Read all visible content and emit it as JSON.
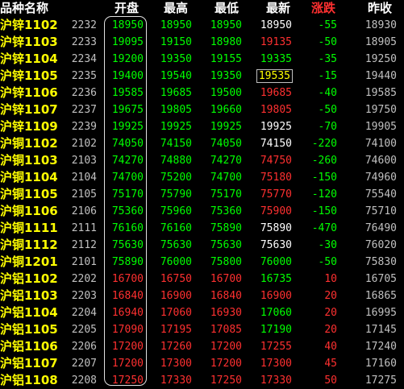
{
  "colors": {
    "header_label": "#ffffff",
    "header_change": "#ff3030",
    "name": "#ffff00",
    "up": "#ff3030",
    "down": "#00ff00",
    "flat": "#ffffff",
    "background": "#000000"
  },
  "headers": {
    "name": "品种名称",
    "open": "开盘",
    "high": "最高",
    "low": "最低",
    "last": "最新",
    "change": "涨跌",
    "prev_close": "昨收"
  },
  "rows": [
    {
      "name": "沪锌1102",
      "code": "2232",
      "open": "18950",
      "high": "18950",
      "low": "18950",
      "last": "18950",
      "change": "-55",
      "prev": "18930",
      "oc": "green",
      "hc": "green",
      "lc": "green",
      "lac": "white",
      "cc": "green"
    },
    {
      "name": "沪锌1103",
      "code": "2233",
      "open": "19095",
      "high": "19150",
      "low": "18980",
      "last": "19135",
      "change": "-50",
      "prev": "18905",
      "oc": "green",
      "hc": "green",
      "lc": "green",
      "lac": "red",
      "cc": "green"
    },
    {
      "name": "沪锌1104",
      "code": "2234",
      "open": "19200",
      "high": "19350",
      "low": "19155",
      "last": "19335",
      "change": "-35",
      "prev": "19250",
      "oc": "green",
      "hc": "green",
      "lc": "green",
      "lac": "green",
      "cc": "green"
    },
    {
      "name": "沪锌1105",
      "code": "2235",
      "open": "19400",
      "high": "19540",
      "low": "19350",
      "last": "19535",
      "change": "-15",
      "prev": "19440",
      "oc": "green",
      "hc": "green",
      "lc": "green",
      "lac": "cur",
      "cc": "green"
    },
    {
      "name": "沪锌1106",
      "code": "2236",
      "open": "19585",
      "high": "19685",
      "low": "19500",
      "last": "19685",
      "change": "-40",
      "prev": "19585",
      "oc": "green",
      "hc": "green",
      "lc": "green",
      "lac": "red",
      "cc": "green"
    },
    {
      "name": "沪锌1107",
      "code": "2237",
      "open": "19675",
      "high": "19805",
      "low": "19660",
      "last": "19805",
      "change": "-50",
      "prev": "19750",
      "oc": "green",
      "hc": "green",
      "lc": "green",
      "lac": "red",
      "cc": "green"
    },
    {
      "name": "沪锌1109",
      "code": "2239",
      "open": "19925",
      "high": "19925",
      "low": "19925",
      "last": "19925",
      "change": "-70",
      "prev": "19905",
      "oc": "green",
      "hc": "green",
      "lc": "green",
      "lac": "white",
      "cc": "green"
    },
    {
      "name": "沪铜1102",
      "code": "2102",
      "open": "74050",
      "high": "74150",
      "low": "74050",
      "last": "74150",
      "change": "-220",
      "prev": "74100",
      "oc": "green",
      "hc": "green",
      "lc": "green",
      "lac": "white",
      "cc": "green"
    },
    {
      "name": "沪铜1103",
      "code": "2103",
      "open": "74270",
      "high": "74880",
      "low": "74270",
      "last": "74750",
      "change": "-260",
      "prev": "74600",
      "oc": "green",
      "hc": "green",
      "lc": "green",
      "lac": "red",
      "cc": "green"
    },
    {
      "name": "沪铜1104",
      "code": "2104",
      "open": "74700",
      "high": "75200",
      "low": "74700",
      "last": "75180",
      "change": "-150",
      "prev": "74960",
      "oc": "green",
      "hc": "green",
      "lc": "green",
      "lac": "red",
      "cc": "green"
    },
    {
      "name": "沪铜1105",
      "code": "2105",
      "open": "75170",
      "high": "75790",
      "low": "75170",
      "last": "75770",
      "change": "-120",
      "prev": "75540",
      "oc": "green",
      "hc": "green",
      "lc": "green",
      "lac": "red",
      "cc": "green"
    },
    {
      "name": "沪铜1106",
      "code": "2106",
      "open": "75360",
      "high": "75960",
      "low": "75360",
      "last": "75900",
      "change": "-150",
      "prev": "75710",
      "oc": "green",
      "hc": "green",
      "lc": "green",
      "lac": "red",
      "cc": "green"
    },
    {
      "name": "沪铜1111",
      "code": "2111",
      "open": "76160",
      "high": "76160",
      "low": "75890",
      "last": "75890",
      "change": "-470",
      "prev": "76490",
      "oc": "green",
      "hc": "green",
      "lc": "green",
      "lac": "white",
      "cc": "green"
    },
    {
      "name": "沪铜1112",
      "code": "2112",
      "open": "75630",
      "high": "75630",
      "low": "75630",
      "last": "75630",
      "change": "-30",
      "prev": "76020",
      "oc": "green",
      "hc": "green",
      "lc": "green",
      "lac": "white",
      "cc": "green"
    },
    {
      "name": "沪铜1201",
      "code": "2101",
      "open": "75890",
      "high": "76000",
      "low": "75800",
      "last": "76000",
      "change": "-50",
      "prev": "75830",
      "oc": "green",
      "hc": "green",
      "lc": "green",
      "lac": "green",
      "cc": "green"
    },
    {
      "name": "沪铝1102",
      "code": "2202",
      "open": "16700",
      "high": "16750",
      "low": "16700",
      "last": "16735",
      "change": "10",
      "prev": "16705",
      "oc": "red",
      "hc": "red",
      "lc": "red",
      "lac": "green",
      "cc": "red"
    },
    {
      "name": "沪铝1103",
      "code": "2203",
      "open": "16840",
      "high": "16900",
      "low": "16840",
      "last": "16900",
      "change": "20",
      "prev": "16865",
      "oc": "red",
      "hc": "red",
      "lc": "red",
      "lac": "red",
      "cc": "red"
    },
    {
      "name": "沪铝1104",
      "code": "2204",
      "open": "16940",
      "high": "17060",
      "low": "16930",
      "last": "17060",
      "change": "20",
      "prev": "16995",
      "oc": "red",
      "hc": "red",
      "lc": "red",
      "lac": "green",
      "cc": "red"
    },
    {
      "name": "沪铝1105",
      "code": "2205",
      "open": "17090",
      "high": "17195",
      "low": "17085",
      "last": "17190",
      "change": "20",
      "prev": "17145",
      "oc": "red",
      "hc": "red",
      "lc": "red",
      "lac": "green",
      "cc": "red"
    },
    {
      "name": "沪铝1106",
      "code": "2206",
      "open": "17200",
      "high": "17260",
      "low": "17200",
      "last": "17255",
      "change": "40",
      "prev": "17240",
      "oc": "red",
      "hc": "red",
      "lc": "red",
      "lac": "red",
      "cc": "red"
    },
    {
      "name": "沪铝1107",
      "code": "2207",
      "open": "17200",
      "high": "17300",
      "low": "17200",
      "last": "17300",
      "change": "45",
      "prev": "17160",
      "oc": "red",
      "hc": "red",
      "lc": "red",
      "lac": "red",
      "cc": "red"
    },
    {
      "name": "沪铝1108",
      "code": "2208",
      "open": "17250",
      "high": "17330",
      "low": "17250",
      "last": "17330",
      "change": "50",
      "prev": "17275",
      "oc": "red",
      "hc": "red",
      "lc": "red",
      "lac": "red",
      "cc": "red"
    }
  ]
}
